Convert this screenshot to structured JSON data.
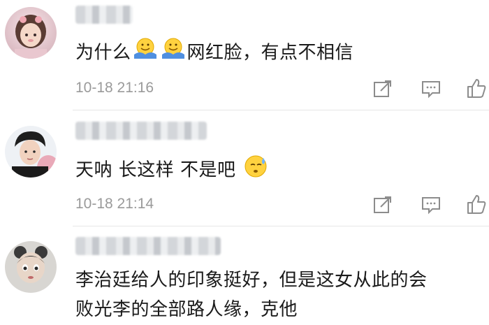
{
  "comments": [
    {
      "text_before": "为什么",
      "text_after": "网红脸，有点不相信",
      "emoji": [
        "smiling-face-shrug-emoji",
        "smiling-face-shrug-emoji"
      ],
      "time": "10-18 21:16"
    },
    {
      "text_before": "天呐 长这样 不是吧",
      "text_after": "",
      "emoji": [
        "sweat-face-emoji"
      ],
      "time": "10-18 21:14"
    },
    {
      "line1": "李治廷给人的印象挺好，但是这女从此的会",
      "line2": "败光李的全部路人缘，克他"
    }
  ],
  "colors": {
    "text": "#1a1a1a",
    "time": "#9a9a9a",
    "icon": "#8c8c8c",
    "divider": "#e6e6e6"
  }
}
